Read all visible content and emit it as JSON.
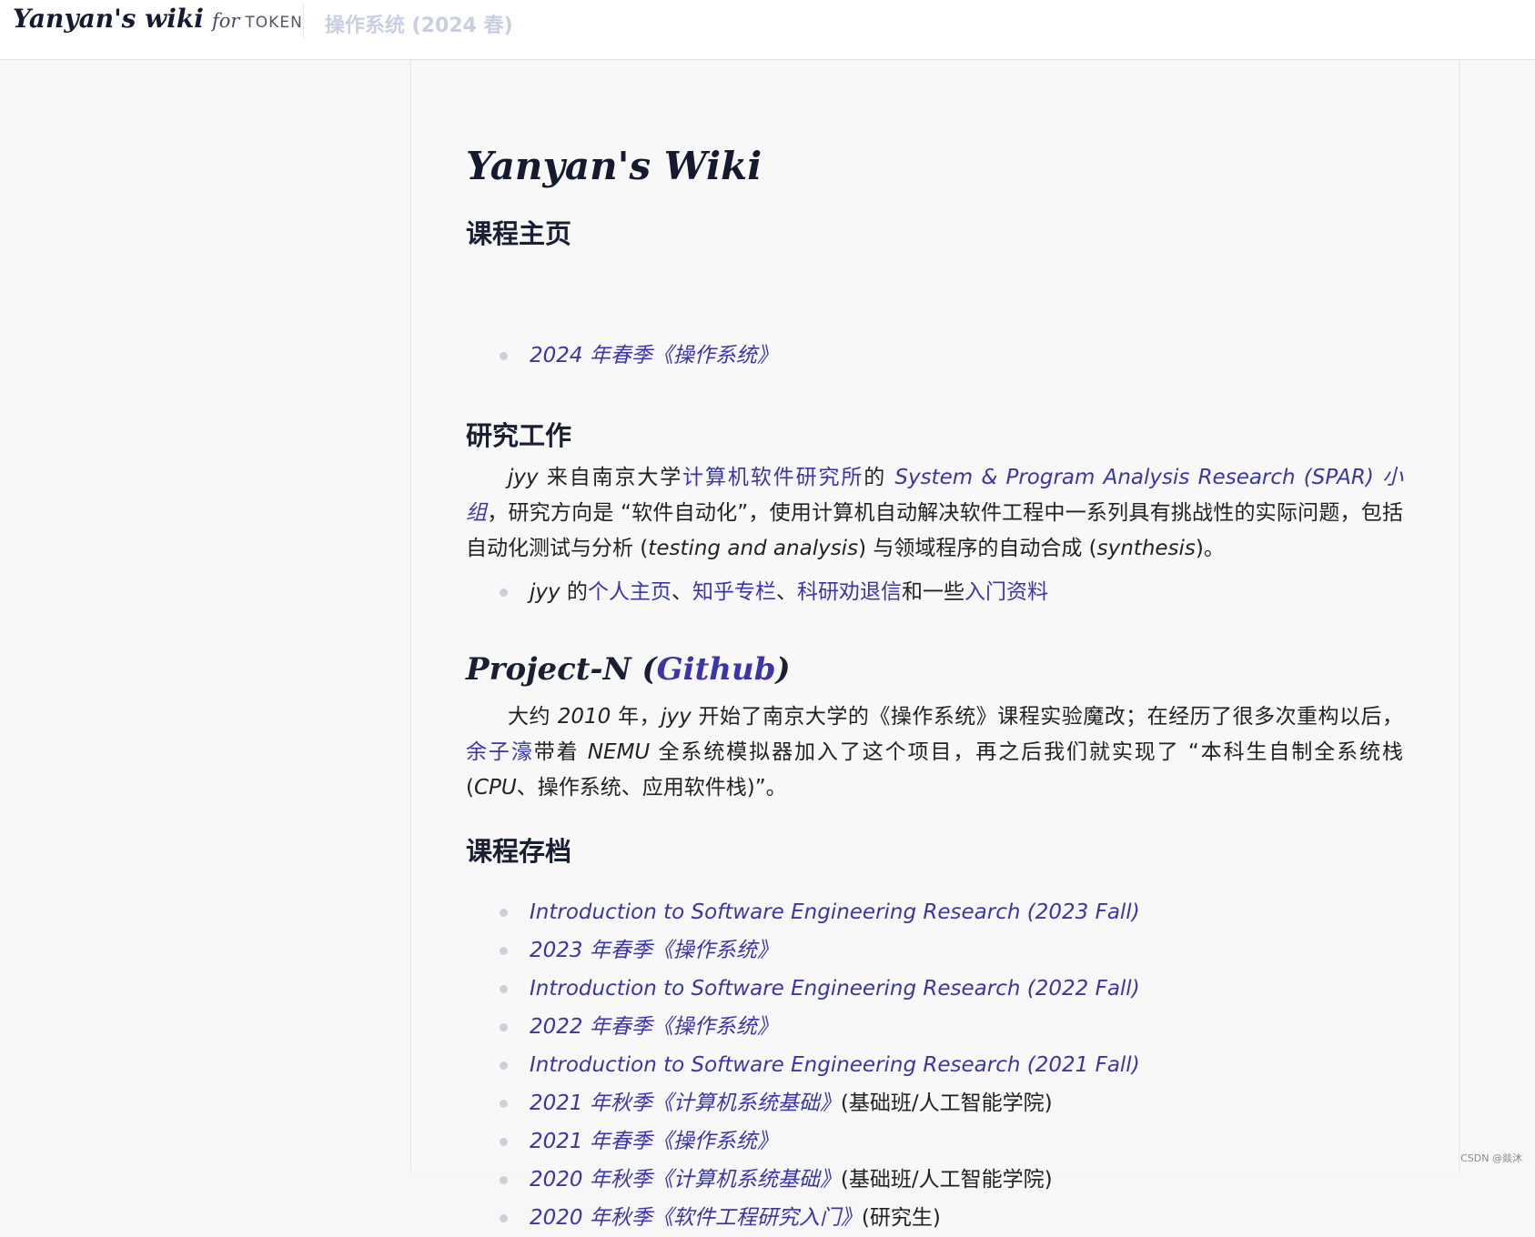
{
  "header": {
    "brand_name": "Yanyan's wiki",
    "brand_for": "for",
    "brand_token": "TOKEN",
    "nav_link": "操作系统 (2024 春)"
  },
  "page": {
    "title": "Yanyan's Wiki",
    "courses_heading": "课程主页",
    "courses": [
      {
        "label": "2024 年春季《操作系统》"
      }
    ],
    "research_heading": "研究工作",
    "research_para": {
      "p1": "jyy",
      "p2": " 来自南京大学",
      "link1": "计算机软件研究所",
      "p3": "的 ",
      "link2": "System & Program Analysis Research (SPAR) 小组",
      "p4": "，研究方向是 “软件自动化”，使用计算机自动解决软件工程中一系列具有挑战性的实际问题，包括自动化测试与分析 (",
      "p5": "testing and analysis",
      "p6": ") 与领域程序的自动合成 (",
      "p7": "synthesis",
      "p8": ")。"
    },
    "research_links": {
      "prefix_it": "jyy",
      "prefix": " 的",
      "link_home": "个人主页",
      "sep1": "、",
      "link_zhihu": "知乎专栏",
      "sep2": "、",
      "link_advice": "科研劝退信",
      "mid": "和一些",
      "link_intro": "入门资料"
    },
    "project_heading": {
      "prefix": "Project-N (",
      "link": "Github",
      "suffix": ")"
    },
    "project_para": {
      "p1": "大约 ",
      "p2": "2010",
      "p3": " 年，",
      "p4": "jyy",
      "p5": " 开始了南京大学的《操作系统》课程实验魔改；在经历了很多次重构以后，",
      "link": "余子濠",
      "p6": "带着 ",
      "p7": "NEMU",
      "p8": " 全系统模拟器加入了这个项目，再之后我们就实现了 “本科生自制全系统栈 (",
      "p9": "CPU",
      "p10": "、操作系统、应用软件栈)”。"
    },
    "archive_heading": "课程存档",
    "archive": [
      {
        "label": "Introduction to Software Engineering Research (2023 Fall)",
        "note": ""
      },
      {
        "label": "2023 年春季《操作系统》",
        "note": ""
      },
      {
        "label": "Introduction to Software Engineering Research (2022 Fall)",
        "note": ""
      },
      {
        "label": "2022 年春季《操作系统》",
        "note": ""
      },
      {
        "label": "Introduction to Software Engineering Research (2021 Fall)",
        "note": ""
      },
      {
        "label": "2021 年秋季《计算机系统基础》",
        "note": "(基础班/人工智能学院)"
      },
      {
        "label": "2021 年春季《操作系统》",
        "note": ""
      },
      {
        "label": "2020 年秋季《计算机系统基础》",
        "note": "(基础班/人工智能学院)"
      },
      {
        "label": "2020 年秋季《软件工程研究入门》",
        "note": "(研究生)"
      }
    ]
  },
  "watermark": "CSDN @燚沐"
}
